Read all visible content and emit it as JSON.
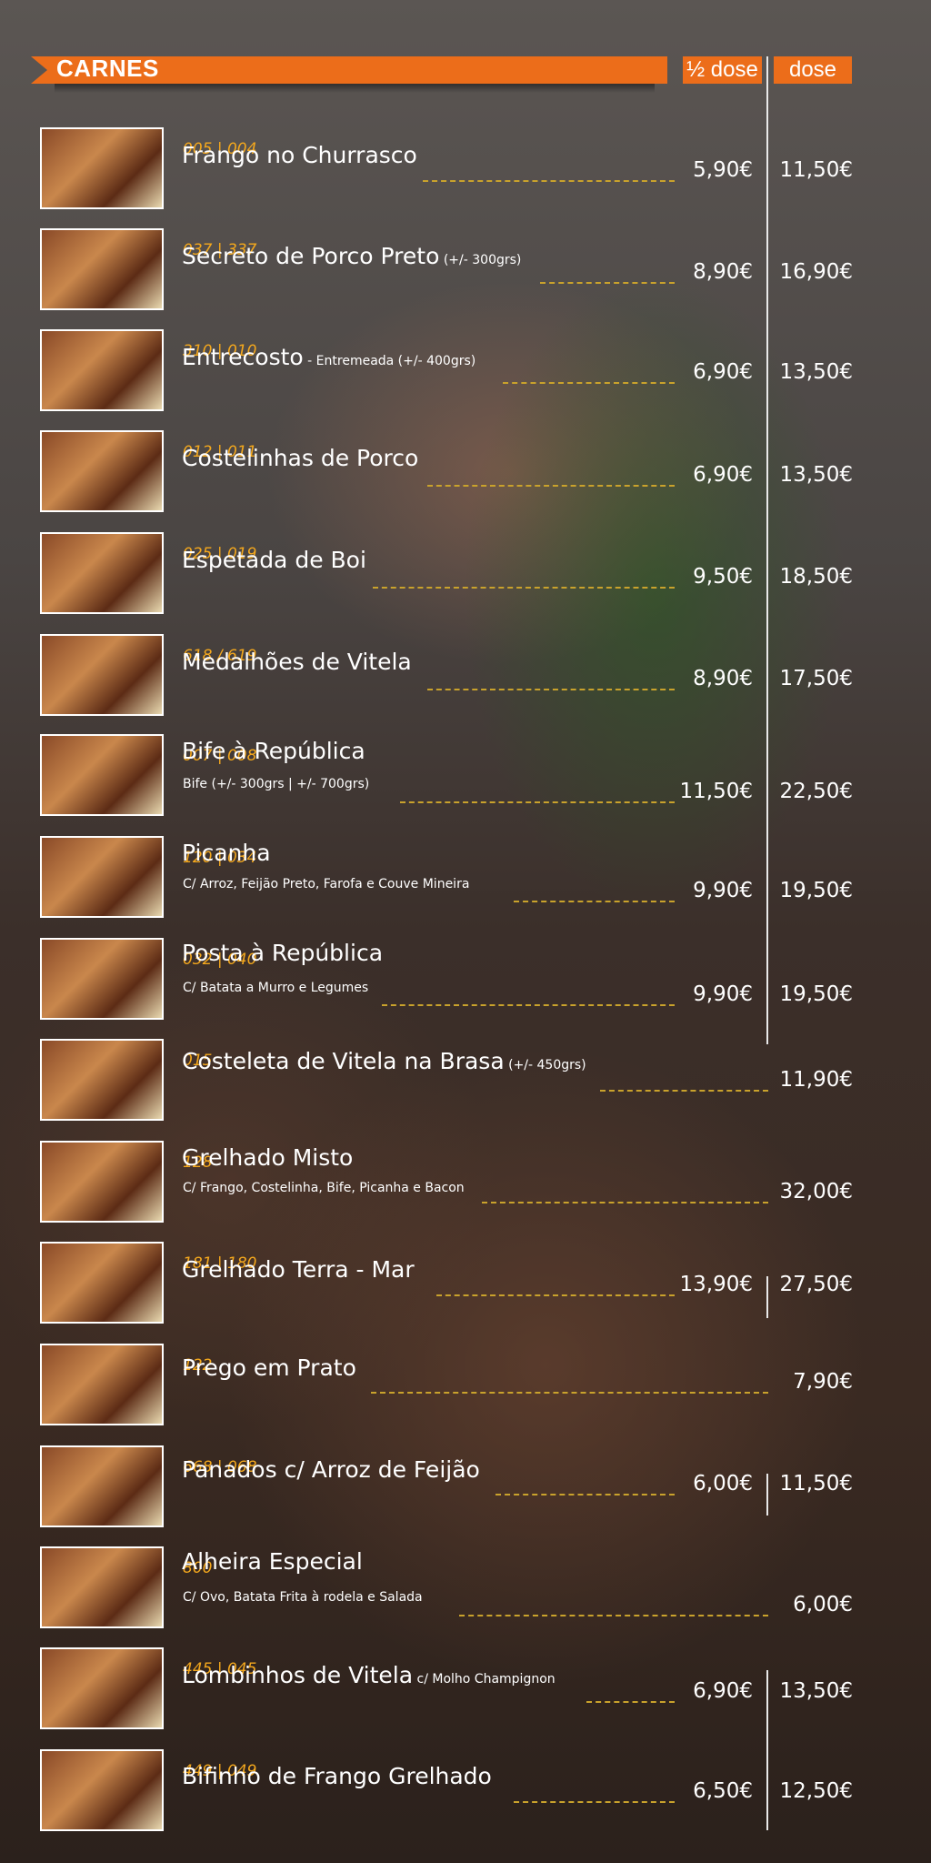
{
  "header": {
    "title": "CARNES",
    "half_label": "½ dose",
    "full_label": "dose"
  },
  "colors": {
    "accent": "#ec6d1a",
    "code": "#f4a81d",
    "dash": "#c9a22c"
  },
  "items": [
    {
      "code": "005 | 004",
      "name": "Frango no Churrasco",
      "note": "",
      "desc": "",
      "half": "5,90€",
      "full": "11,50€"
    },
    {
      "code": "037 | 337",
      "name": "Secreto de Porco Preto",
      "note": "(+/- 300grs)",
      "desc": "",
      "half": "8,90€",
      "full": "16,90€"
    },
    {
      "code": "310 | 010",
      "name": "Entrecosto",
      "note": " - Entremeada (+/- 400grs)",
      "desc": "",
      "half": "6,90€",
      "full": "13,50€"
    },
    {
      "code": "012 | 011",
      "name": "Costelinhas de Porco",
      "note": "",
      "desc": "",
      "half": "6,90€",
      "full": "13,50€"
    },
    {
      "code": "025 | 019",
      "name": "Espetada de Boi",
      "note": "",
      "desc": "",
      "half": "9,50€",
      "full": "18,50€"
    },
    {
      "code": "618 / 619",
      "name": "Medalhões de Vitela",
      "note": "",
      "desc": "",
      "half": "8,90€",
      "full": "17,50€"
    },
    {
      "code": "007 | 008",
      "name": "Bife à República",
      "note": "",
      "desc": "Bife (+/- 300grs | +/- 700grs)",
      "half": "11,50€",
      "full": "22,50€"
    },
    {
      "code": "120 | 034",
      "name": "Picanha",
      "note": "",
      "desc": "C/ Arroz, Feijão Preto, Farofa e Couve Mineira",
      "half": "9,90€",
      "full": "19,50€"
    },
    {
      "code": "032 | 040",
      "name": "Posta à República",
      "note": "",
      "desc": "C/ Batata a Murro e Legumes",
      "half": "9,90€",
      "full": "19,50€"
    },
    {
      "code": "015",
      "name": "Costeleta de Vitela na Brasa",
      "note": "(+/- 450grs)",
      "desc": "",
      "half": "",
      "full": "11,90€"
    },
    {
      "code": "128",
      "name": "Grelhado Misto",
      "note": "",
      "desc": "C/ Frango, Costelinha, Bife, Picanha e Bacon",
      "half": "",
      "full": "32,00€"
    },
    {
      "code": "181 | 180",
      "name": "Grelhado Terra - Mar",
      "note": "",
      "desc": "",
      "half": "13,90€",
      "full": "27,50€"
    },
    {
      "code": "122",
      "name": "Prego em Prato",
      "note": "",
      "desc": "",
      "half": "",
      "full": "7,90€"
    },
    {
      "code": "668 | 068",
      "name": "Panados c/ Arroz de Feijão",
      "note": "",
      "desc": "",
      "half": "6,00€",
      "full": "11,50€"
    },
    {
      "code": "800",
      "name": "Alheira Especial",
      "note": "",
      "desc": "C/ Ovo,  Batata Frita à rodela e Salada",
      "half": "",
      "full": "6,00€"
    },
    {
      "code": "445 | 045",
      "name": "Lombinhos de Vitela",
      "note": "c/ Molho Champignon",
      "desc": "",
      "half": "6,90€",
      "full": "13,50€"
    },
    {
      "code": "449 | 049",
      "name": "Bifinho de Frango Grelhado",
      "note": "",
      "desc": "",
      "half": "6,50€",
      "full": "12,50€"
    }
  ]
}
